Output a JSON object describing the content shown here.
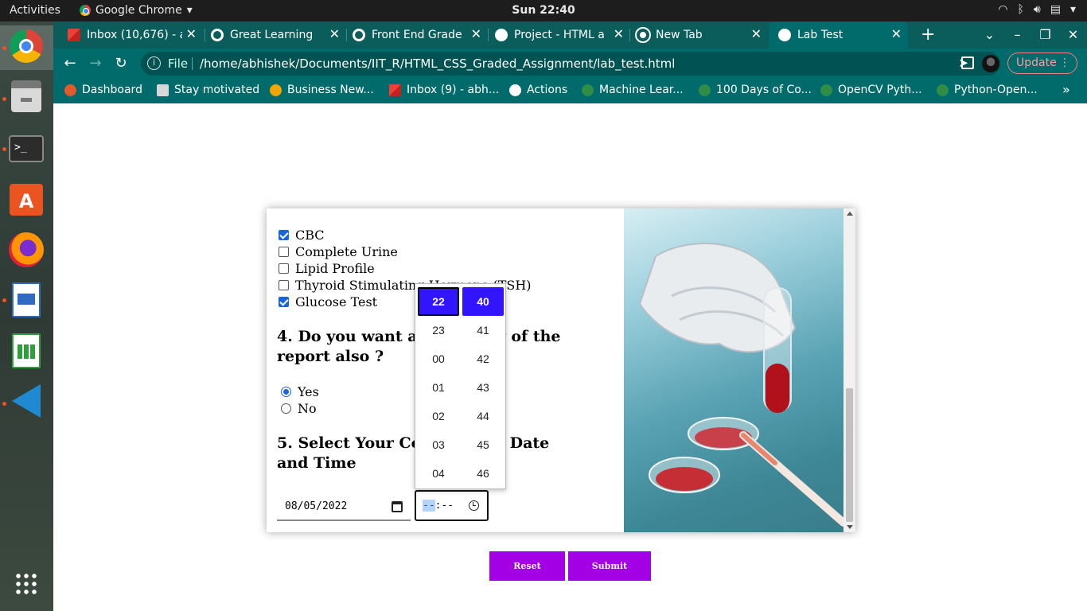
{
  "topbar": {
    "activities": "Activities",
    "app_name": "Google Chrome",
    "clock": "Sun 22:40"
  },
  "tabs": [
    {
      "label": "Inbox (10,676) - a",
      "icon_color": "#ea4335"
    },
    {
      "label": "Great Learning",
      "icon_color": "#ffffff"
    },
    {
      "label": "Front End Grade",
      "icon_color": "#ffffff"
    },
    {
      "label": "Project - HTML a",
      "icon_color": "#ffffff"
    },
    {
      "label": "New Tab",
      "icon_color": "#ffffff"
    },
    {
      "label": "Lab Test",
      "icon_color": "#ffffff"
    }
  ],
  "toolbar": {
    "file_label": "File",
    "url": "/home/abhishek/Documents/IIT_R/HTML_CSS_Graded_Assignment/lab_test.html",
    "update_label": "Update"
  },
  "bookmarks": [
    "Dashboard",
    "Stay motivated",
    "Business New...",
    "Inbox (9) - abh...",
    "Actions",
    "Machine Lear...",
    "100 Days of Co...",
    "OpenCV Pyth...",
    "Python-Open..."
  ],
  "form": {
    "tests": [
      {
        "label": "CBC",
        "checked": true
      },
      {
        "label": "Complete Urine",
        "checked": false
      },
      {
        "label": "Lipid Profile",
        "checked": false
      },
      {
        "label": "Thyroid Stimulating Hormone (TSH)",
        "checked": false
      },
      {
        "label": "Glucose Test",
        "checked": true
      }
    ],
    "q4_line1": "4. Do you want a hard copy of the",
    "q4_line2": "report also ?",
    "radio_yes": "Yes",
    "radio_no": "No",
    "q5_line1": "5. Select Your Comfortable Date",
    "q5_line2": "and Time",
    "date_value": "08/05/2022",
    "time_hh": "--",
    "time_rest": ":--"
  },
  "time_picker": {
    "hours": [
      "22",
      "23",
      "00",
      "01",
      "02",
      "03",
      "04"
    ],
    "minutes": [
      "40",
      "41",
      "42",
      "43",
      "44",
      "45",
      "46"
    ],
    "selected_color": "#3314ff"
  },
  "buttons": {
    "reset": "Reset",
    "submit": "Submit",
    "color": "#a300e6"
  },
  "colors": {
    "chrome_tabstrip": "#0b5d5b",
    "chrome_toolbar": "#006b6a"
  }
}
